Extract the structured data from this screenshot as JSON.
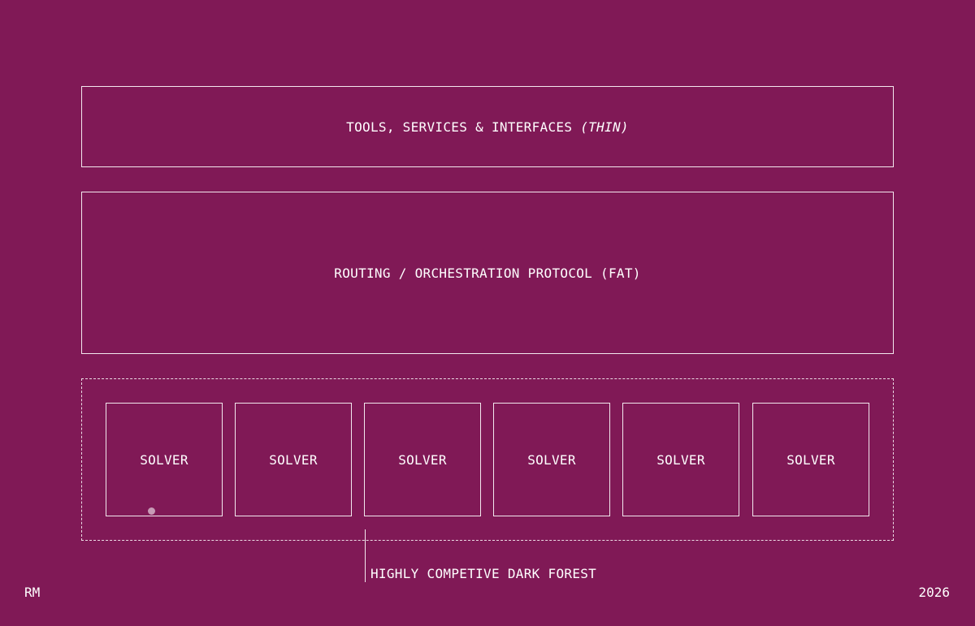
{
  "layers": {
    "top": {
      "label": "TOOLS, SERVICES & INTERFACES",
      "qualifier": "(THIN)"
    },
    "middle": {
      "label": "ROUTING / ORCHESTRATION PROTOCOL (FAT)"
    }
  },
  "solvers": [
    {
      "label": "SOLVER"
    },
    {
      "label": "SOLVER"
    },
    {
      "label": "SOLVER"
    },
    {
      "label": "SOLVER"
    },
    {
      "label": "SOLVER"
    },
    {
      "label": "SOLVER"
    }
  ],
  "callout": {
    "label": "HIGHLY COMPETIVE DARK FOREST"
  },
  "footer": {
    "left": "RM",
    "right": "2026"
  },
  "colors": {
    "background": "#801956",
    "stroke": "#ffffff",
    "dot": "#c79bb6"
  }
}
